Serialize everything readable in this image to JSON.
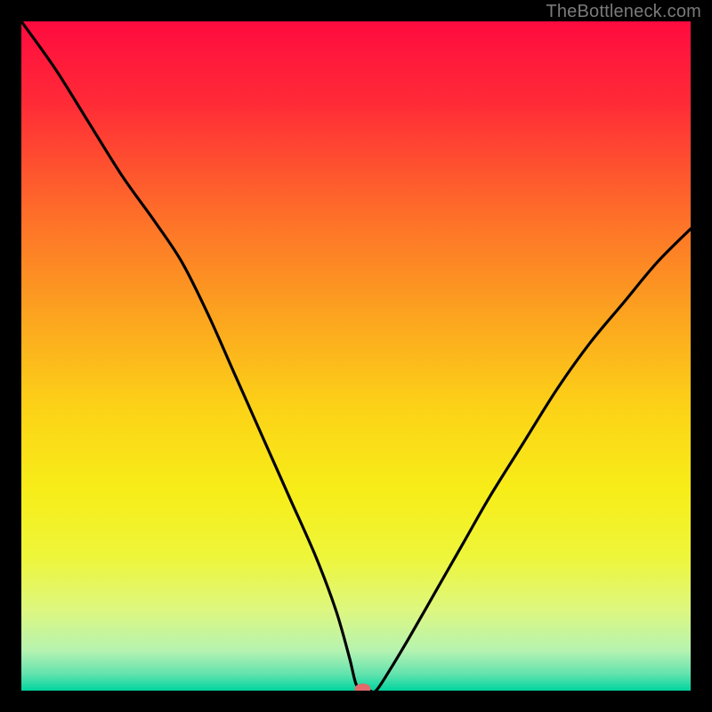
{
  "watermark": "TheBottleneck.com",
  "chart_data": {
    "type": "line",
    "title": "",
    "xlabel": "",
    "ylabel": "",
    "xlim": [
      0,
      100
    ],
    "ylim": [
      0,
      100
    ],
    "background_gradient_stops": [
      {
        "offset": 0.0,
        "color": "#ff0b3f"
      },
      {
        "offset": 0.12,
        "color": "#ff2a37"
      },
      {
        "offset": 0.28,
        "color": "#fe6b2a"
      },
      {
        "offset": 0.44,
        "color": "#fca41f"
      },
      {
        "offset": 0.58,
        "color": "#fcd317"
      },
      {
        "offset": 0.7,
        "color": "#f7ed18"
      },
      {
        "offset": 0.8,
        "color": "#eef63a"
      },
      {
        "offset": 0.88,
        "color": "#ddf780"
      },
      {
        "offset": 0.94,
        "color": "#b6f3b0"
      },
      {
        "offset": 0.975,
        "color": "#63e3af"
      },
      {
        "offset": 1.0,
        "color": "#00d49e"
      }
    ],
    "series": [
      {
        "name": "bottleneck-curve",
        "x": [
          0,
          5,
          10,
          15,
          20,
          24,
          28,
          32,
          36,
          40,
          44,
          47,
          49,
          50,
          51,
          52,
          53,
          55,
          58,
          62,
          66,
          70,
          75,
          80,
          85,
          90,
          95,
          100
        ],
        "y": [
          100,
          93,
          85,
          77,
          70,
          64,
          56,
          47,
          38,
          29,
          20,
          12,
          5,
          1,
          0,
          0,
          0,
          3,
          8,
          15,
          22,
          29,
          37,
          45,
          52,
          58,
          64,
          69
        ]
      }
    ],
    "marker": {
      "name": "optimal-point",
      "x": 51,
      "y": 0,
      "color": "#e26a6a",
      "rx": 9,
      "ry": 6
    }
  }
}
